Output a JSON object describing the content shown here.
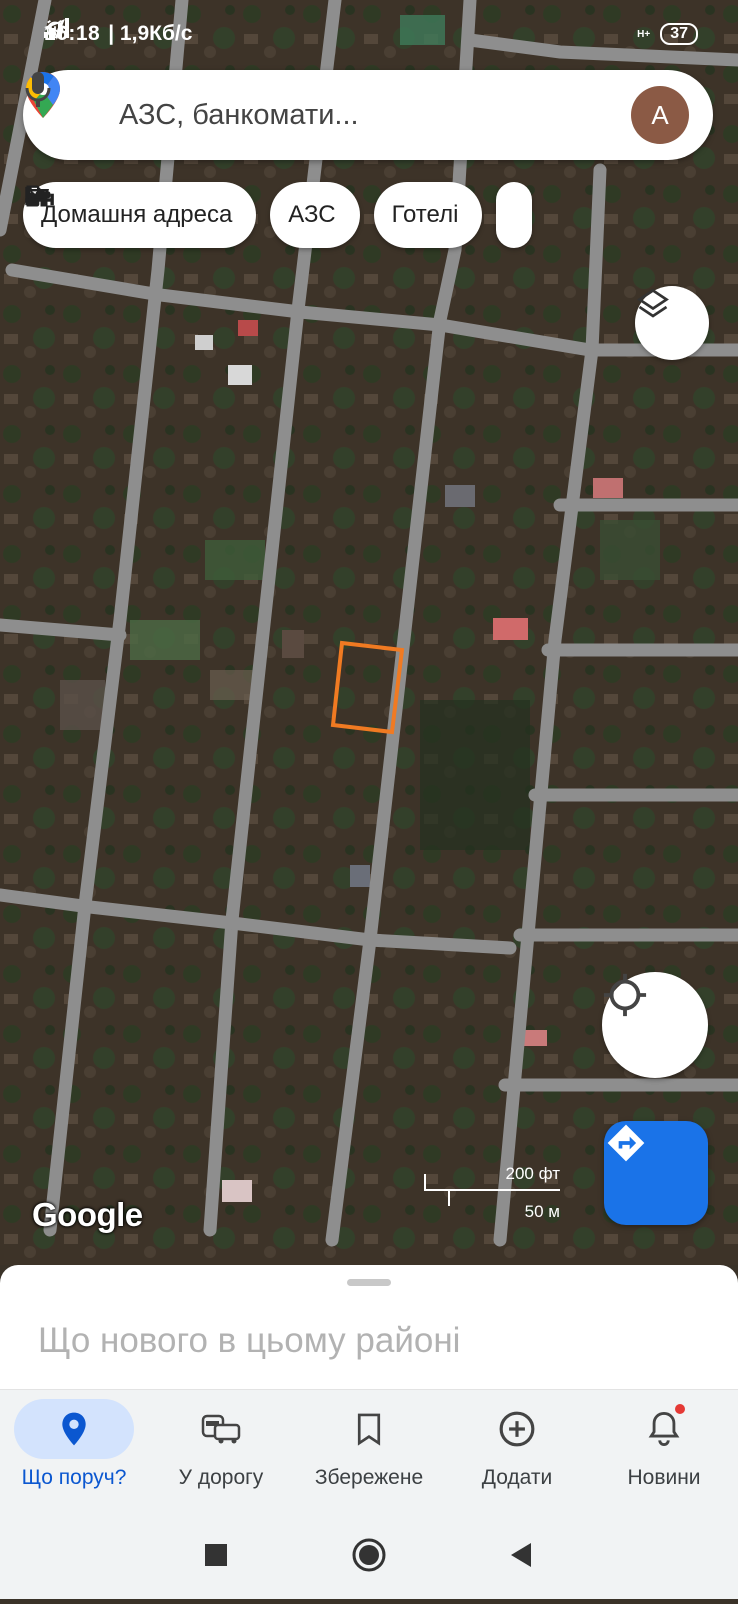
{
  "status_bar": {
    "time": "16:18",
    "network_speed": "| 1,9Кб/с",
    "signal_label": "H+",
    "battery": "37"
  },
  "search": {
    "placeholder": "АЗС, банкомати...",
    "avatar_letter": "A"
  },
  "chips": [
    {
      "label": "Домашня адреса",
      "icon": "home-icon"
    },
    {
      "label": "АЗС",
      "icon": "gas-station-icon"
    },
    {
      "label": "Готелі",
      "icon": "hotel-bed-icon"
    }
  ],
  "map": {
    "scale_imperial": "200 фт",
    "scale_metric": "50 м",
    "attribution": "Google",
    "highlight_color": "#f07a22"
  },
  "sheet": {
    "title": "Що нового в цьому районі"
  },
  "bottom_nav": [
    {
      "label": "Що поруч?",
      "icon": "map-pin-icon",
      "active": true
    },
    {
      "label": "У дорогу",
      "icon": "commute-icon",
      "active": false
    },
    {
      "label": "Збережене",
      "icon": "bookmark-icon",
      "active": false
    },
    {
      "label": "Додати",
      "icon": "add-circle-icon",
      "active": false
    },
    {
      "label": "Новини",
      "icon": "bell-icon",
      "active": false
    }
  ],
  "colors": {
    "accent": "#1a73e8",
    "active_pill": "#d3e3fd",
    "notification_dot": "#e53935"
  }
}
